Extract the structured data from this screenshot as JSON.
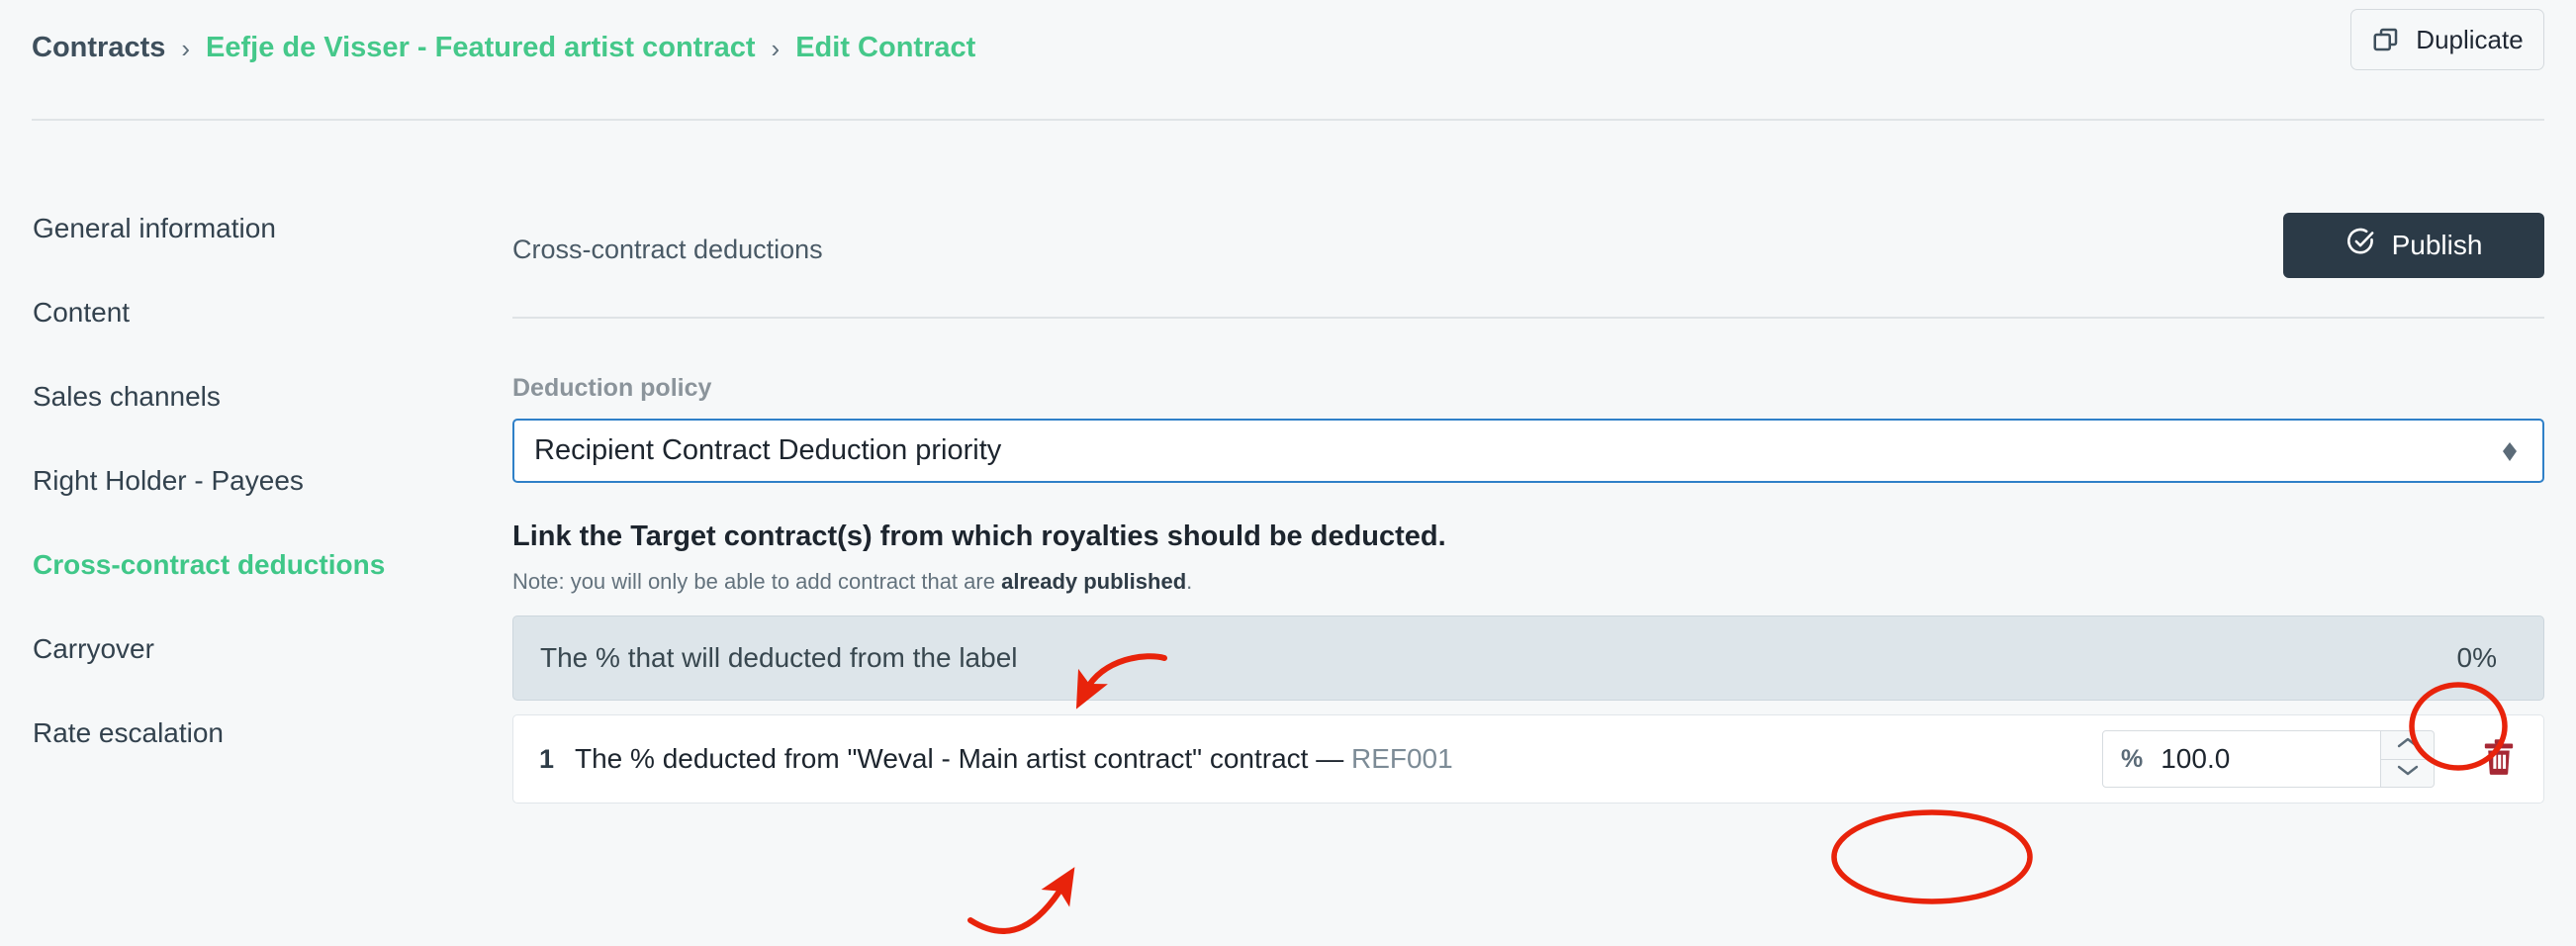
{
  "breadcrumb": {
    "root": "Contracts",
    "separator": "›",
    "contract": "Eefje de Visser - Featured artist contract",
    "current": "Edit Contract"
  },
  "topbar": {
    "duplicate_label": "Duplicate",
    "duplicate_icon": "copy-icon"
  },
  "sidebar": {
    "items": [
      {
        "label": "General information",
        "active": false
      },
      {
        "label": "Content",
        "active": false
      },
      {
        "label": "Sales channels",
        "active": false
      },
      {
        "label": "Right Holder - Payees",
        "active": false
      },
      {
        "label": "Cross-contract deductions",
        "active": true
      },
      {
        "label": "Carryover",
        "active": false
      },
      {
        "label": "Rate escalation",
        "active": false
      }
    ]
  },
  "main": {
    "title": "Cross-contract deductions",
    "publish_label": "Publish",
    "publish_icon": "check-circle-icon",
    "deduction_policy": {
      "label": "Deduction policy",
      "selected": "Recipient Contract Deduction priority",
      "indicator_icon": "select-arrows-icon"
    },
    "section_heading": "Link the Target contract(s) from which royalties should be deducted.",
    "note_prefix": "Note: you will only be able to add contract that are ",
    "note_bold": "already published",
    "note_suffix": ".",
    "banner": {
      "text": "The % that will deducted from the label",
      "percent": "0%"
    },
    "rows": [
      {
        "index": "1",
        "text": "The % deducted from \"Weval - Main artist contract\" contract — ",
        "ref": "REF001",
        "percent_sign": "%",
        "percent_value": "100.0",
        "stepper_up_icon": "chevron-up-icon",
        "stepper_down_icon": "chevron-down-icon",
        "delete_icon": "trash-icon"
      }
    ]
  },
  "colors": {
    "accent_green": "#45c88a",
    "publish_bg": "#2b3a47",
    "focus_blue": "#2f80c8",
    "banner_bg": "#dde5ea",
    "trash_red": "#a62834",
    "annotation_red": "#e8230b",
    "page_bg": "#f6f8f9"
  },
  "annotations": [
    {
      "name": "arrow-to-banner-label",
      "type": "curved-arrow"
    },
    {
      "name": "ellipse-around-banner-percent",
      "type": "ellipse"
    },
    {
      "name": "arrow-to-row-text",
      "type": "curved-arrow"
    },
    {
      "name": "ellipse-around-row-percent",
      "type": "ellipse"
    }
  ]
}
